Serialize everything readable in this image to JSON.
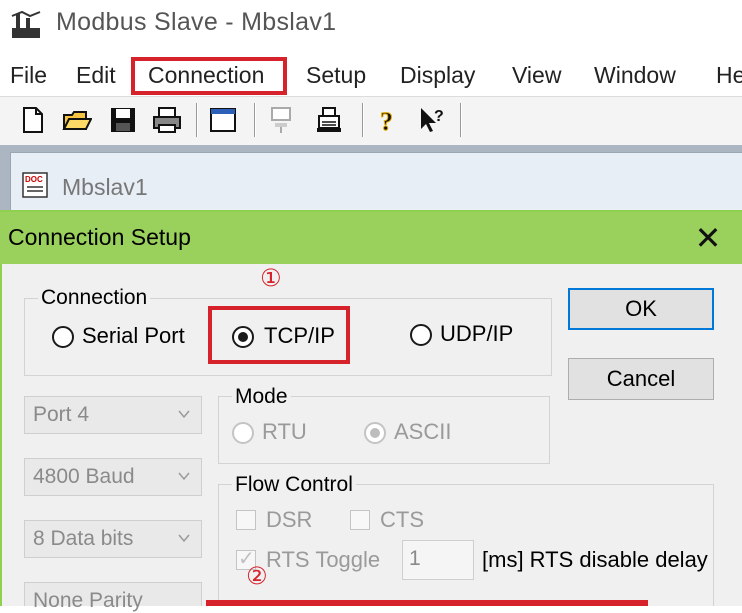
{
  "app": {
    "title": "Modbus Slave - Mbslav1"
  },
  "menu": [
    {
      "label": "File"
    },
    {
      "label": "Edit"
    },
    {
      "label": "Connection"
    },
    {
      "label": "Setup"
    },
    {
      "label": "Display"
    },
    {
      "label": "View"
    },
    {
      "label": "Window"
    },
    {
      "label": "He"
    }
  ],
  "toolbar_icons": [
    "new-file-icon",
    "open-folder-icon",
    "save-icon",
    "print-icon",
    "window-icon",
    "connect-icon",
    "printer-disabled-icon",
    "help-icon",
    "context-help-icon"
  ],
  "child_window": {
    "title": "Mbslav1"
  },
  "dialog": {
    "title": "Connection Setup",
    "close_glyph": "✕",
    "connection": {
      "label": "Connection",
      "options": [
        "Serial Port",
        "TCP/IP",
        "UDP/IP"
      ],
      "selected": "TCP/IP"
    },
    "ok_label": "OK",
    "cancel_label": "Cancel",
    "port": "Port 4",
    "baud": "4800 Baud",
    "data_bits": "8 Data bits",
    "parity": "None Parity",
    "mode": {
      "label": "Mode",
      "options": [
        "RTU",
        "ASCII"
      ],
      "selected": "ASCII"
    },
    "flow": {
      "label": "Flow Control",
      "dsr": "DSR",
      "cts": "CTS",
      "rts_toggle": "RTS Toggle",
      "rts_checked": true,
      "rts_delay": "1",
      "rts_delay_label": "[ms] RTS disable delay"
    }
  },
  "annotations": {
    "one": "①",
    "two": "②"
  },
  "colors": {
    "highlight_red": "#d6222a",
    "dialog_title_green": "#9ad15c",
    "default_button_blue": "#0078d7"
  }
}
